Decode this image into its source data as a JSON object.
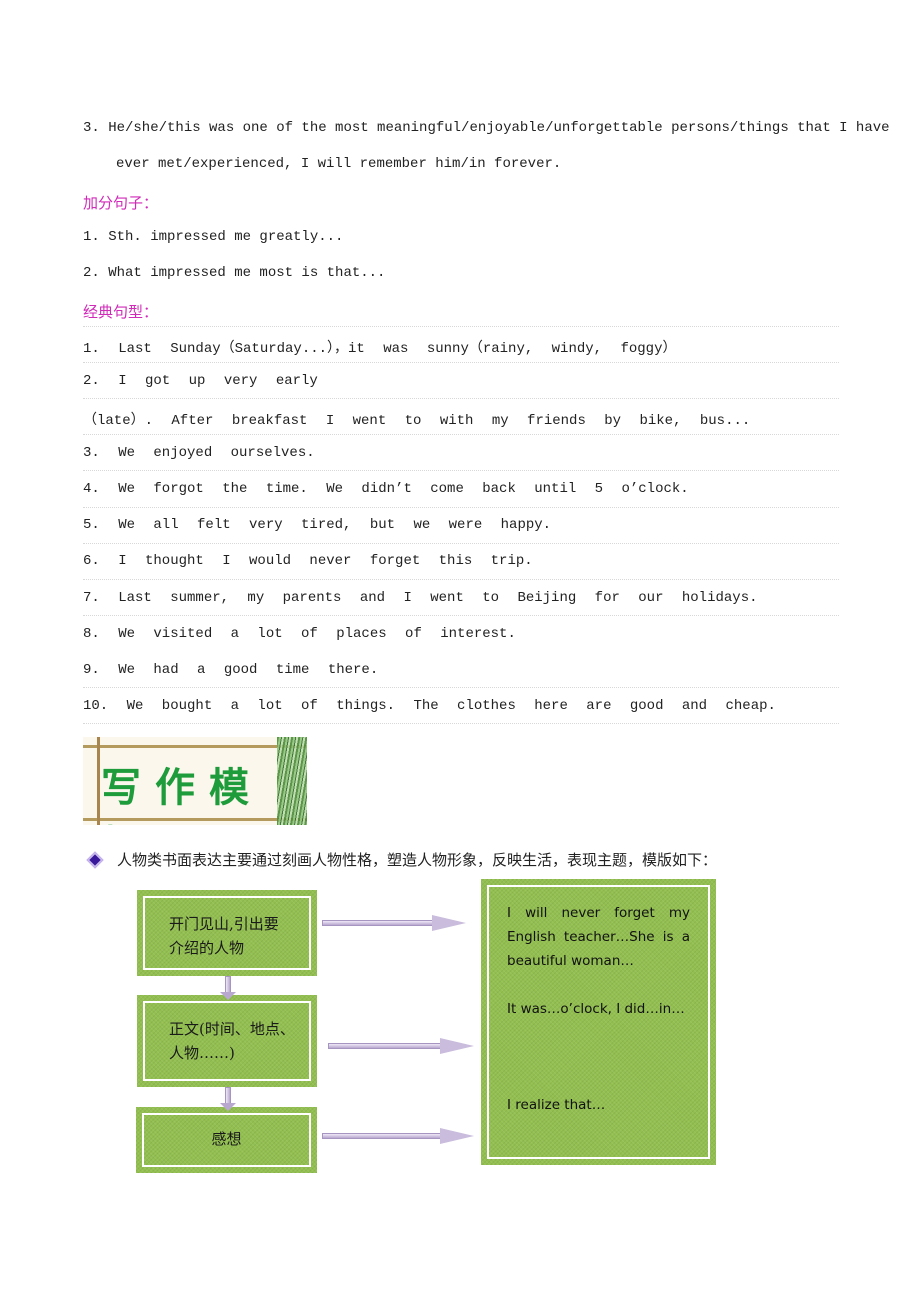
{
  "template_sentence": {
    "line1": "3. He/she/this was one of the most meaningful/enjoyable/unforgettable persons/things that I have",
    "line2": "ever met/experienced,  I will remember him/in forever."
  },
  "bonus_sentences": {
    "heading": "加分句子：",
    "items": [
      "1. Sth. impressed me greatly...",
      "2. What impressed me most is that..."
    ]
  },
  "classic_patterns": {
    "heading": "经典句型：",
    "items": [
      "1.  Last  Sunday（Saturday...），it  was  sunny（rainy,  windy,  foggy）",
      "2.  I  got  up  very  early",
      "（late）.  After  breakfast  I  went  to  with  my  friends  by  bike,  bus...",
      "3.  We  enjoyed  ourselves.",
      "4.  We  forgot  the  time.  We  didn’t  come  back  until  5  o’clock.",
      "5.  We  all  felt  very  tired,  but  we  were  happy.",
      "6.  I  thought  I  would  never  forget  this  trip.",
      "7.  Last  summer,  my  parents  and  I  went  to  Beijing  for  our  holidays.",
      "8.  We  visited  a  lot  of  places  of  interest.",
      "9.  We  had  a  good  time  there.",
      "10.  We  bought  a  lot  of  things.  The  clothes  here  are  good  and  cheap."
    ]
  },
  "banner": {
    "title": "写作模板"
  },
  "intro": {
    "icon": "diamond-bullet-icon",
    "text": "人物类书面表达主要通过刻画人物性格，塑造人物形象，反映生活，表现主题，模版如下："
  },
  "flowchart": {
    "left_boxes": [
      {
        "lines": [
          "开门见山,引出要",
          "介绍的人物"
        ]
      },
      {
        "lines": [
          "正文(时间、地点、",
          "人物……)"
        ]
      },
      {
        "lines": [
          "感想"
        ]
      }
    ],
    "right_box": {
      "paragraphs": [
        [
          "I  will  never  forget  my",
          "English  teacher…She  is  a",
          "beautiful woman…"
        ],
        [
          "It was…o’clock, I did…in…"
        ],
        [
          "I realize that…"
        ]
      ]
    },
    "colors": {
      "box_green": "#92bf50",
      "arrow_lavender": "#c9bcdc"
    }
  },
  "colors": {
    "heading_magenta": "#d02ab8",
    "banner_text_green": "#1e9b3a"
  }
}
